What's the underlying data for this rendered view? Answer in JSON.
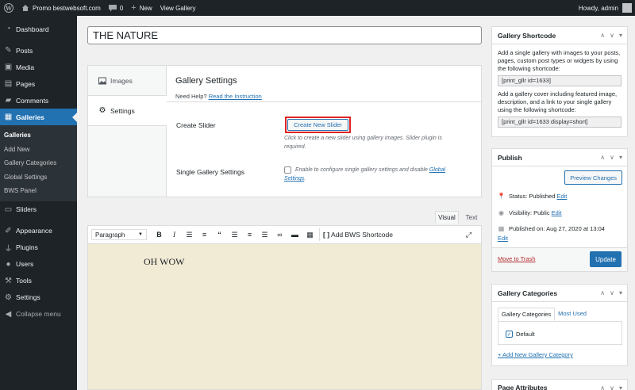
{
  "admin_bar": {
    "site_name": "Promo bestwebsoft.com",
    "comments_count": "0",
    "new_label": "New",
    "view_label": "View Gallery",
    "howdy": "Howdy, admin"
  },
  "sidebar": {
    "items": [
      {
        "label": "Dashboard",
        "icon": "dashboard-icon"
      },
      {
        "label": "Posts",
        "icon": "pin-icon"
      },
      {
        "label": "Media",
        "icon": "media-icon"
      },
      {
        "label": "Pages",
        "icon": "pages-icon"
      },
      {
        "label": "Comments",
        "icon": "comments-icon"
      },
      {
        "label": "Galleries",
        "icon": "gallery-icon"
      },
      {
        "label": "Sliders",
        "icon": "slider-icon"
      },
      {
        "label": "Appearance",
        "icon": "brush-icon"
      },
      {
        "label": "Plugins",
        "icon": "plugin-icon"
      },
      {
        "label": "Users",
        "icon": "users-icon"
      },
      {
        "label": "Tools",
        "icon": "tools-icon"
      },
      {
        "label": "Settings",
        "icon": "settings-icon"
      },
      {
        "label": "Collapse menu",
        "icon": "collapse-icon"
      }
    ],
    "submenu": [
      "Galleries",
      "Add New",
      "Gallery Categories",
      "Global Settings",
      "BWS Panel"
    ]
  },
  "title_value": "THE NATURE",
  "gallery_box": {
    "tabs": [
      "Images",
      "Settings"
    ],
    "heading": "Gallery Settings",
    "help_prefix": "Need Help?",
    "help_link": "Read the Instruction",
    "create_slider_label": "Create Slider",
    "create_slider_button": "Create New Slider",
    "create_slider_desc_1": "Click to create a new slider using gallery images. Slider plugin is",
    "create_slider_desc_2": "required.",
    "single_label": "Single Gallery Settings",
    "single_desc_1": "Enable to configure single gallery settings and disable",
    "single_desc_link_1": "Global",
    "single_desc_link_2": "Settings",
    "single_desc_end": "."
  },
  "editor": {
    "tab_visual": "Visual",
    "tab_text": "Text",
    "format": "Paragraph",
    "bws_button": "Add BWS Shortcode",
    "content": "OH WOW"
  },
  "shortcode_box": {
    "title": "Gallery Shortcode",
    "text1": "Add a single gallery with images to your posts, pages, custom post types or widgets by using the following shortcode:",
    "code1": "[print_gllr id=1633]",
    "text2": "Add a gallery cover including featured image, description, and a link to your single gallery using the following shortcode:",
    "code2": "[print_gllr id=1633 display=short]"
  },
  "publish_box": {
    "title": "Publish",
    "preview": "Preview Changes",
    "status_label": "Status: Published",
    "visibility_label": "Visibility: Public",
    "published_label": "Published on: Aug 27, 2020 at 13:04",
    "edit": "Edit",
    "trash": "Move to Trash",
    "update": "Update"
  },
  "categories_box": {
    "title": "Gallery Categories",
    "tab_all": "Gallery Categories",
    "tab_used": "Most Used",
    "default_cat": "Default",
    "add_new": "+ Add New Gallery Category"
  },
  "attributes_box": {
    "title": "Page Attributes"
  }
}
